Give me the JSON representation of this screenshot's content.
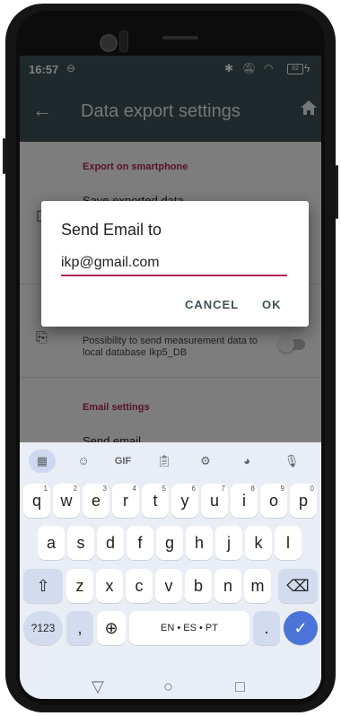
{
  "status": {
    "time": "16:57",
    "battery": "92"
  },
  "app": {
    "title": "Data export settings"
  },
  "settings": {
    "section_export": "Export on smartphone",
    "row1_partial": "Save exported data",
    "row2_text": "Possibility to send measurement data to local database Ikp5_DB",
    "section_email": "Email settings",
    "row3_partial": "Send email"
  },
  "dialog": {
    "title": "Send Email to",
    "value": "ikp@gmail.com",
    "cancel": "CANCEL",
    "ok": "OK"
  },
  "keyboard": {
    "row1": [
      {
        "k": "q",
        "s": "1"
      },
      {
        "k": "w",
        "s": "2"
      },
      {
        "k": "e",
        "s": "3"
      },
      {
        "k": "r",
        "s": "4"
      },
      {
        "k": "t",
        "s": "5"
      },
      {
        "k": "y",
        "s": "6"
      },
      {
        "k": "u",
        "s": "7"
      },
      {
        "k": "i",
        "s": "8"
      },
      {
        "k": "o",
        "s": "9"
      },
      {
        "k": "p",
        "s": "0"
      }
    ],
    "row2": [
      "a",
      "s",
      "d",
      "f",
      "g",
      "h",
      "j",
      "k",
      "l"
    ],
    "row3": [
      "z",
      "x",
      "c",
      "v",
      "b",
      "n",
      "m"
    ],
    "sym": "?123",
    "comma": ",",
    "space": "EN • ES • PT",
    "period": ".",
    "gif": "GIF"
  },
  "colors": {
    "appbar": "#3e5155",
    "accent": "#b0245a",
    "enter": "#4c74d8"
  }
}
